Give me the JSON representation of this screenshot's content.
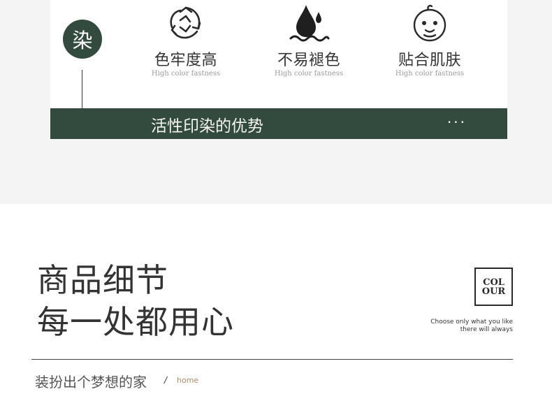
{
  "badge": {
    "char": "染"
  },
  "features": [
    {
      "icon": "recycle-icon",
      "title": "色牢度高",
      "subtitle": "High color fastness"
    },
    {
      "icon": "water-drop-icon",
      "title": "不易褪色",
      "subtitle": "High color fastness"
    },
    {
      "icon": "baby-face-icon",
      "title": "贴合肌肤",
      "subtitle": "High color fastness"
    }
  ],
  "banner": {
    "label": "活性印染的优势",
    "more": "···"
  },
  "details": {
    "heading_line1": "商品细节",
    "heading_line2": "每一处都用心",
    "colour_box": {
      "line1": "COL",
      "line2": "OUR"
    },
    "tagline_line1": "Choose only what you like",
    "tagline_line2": "there will always",
    "slogan": "装扮出个梦想的家",
    "separator": "/",
    "home_link": "home"
  },
  "colors": {
    "accent_green": "#334a3f",
    "link": "#b08a63",
    "band": "#f4f4f4"
  }
}
